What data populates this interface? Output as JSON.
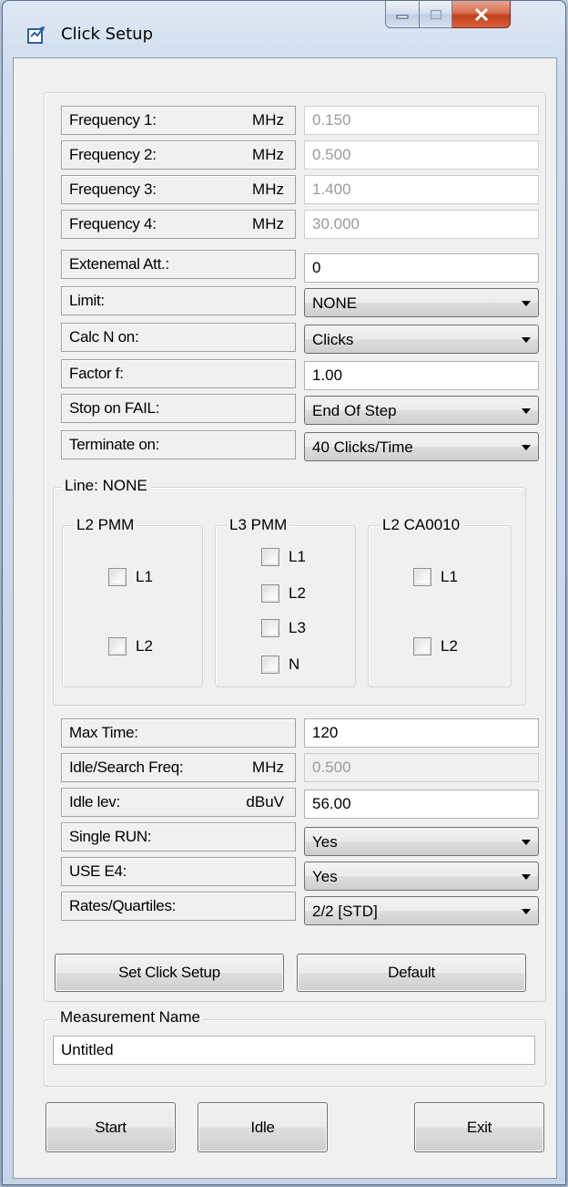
{
  "window": {
    "title": "Click Setup"
  },
  "params": [
    {
      "label": "Frequency 1:",
      "unit": "MHz",
      "value": "0.150"
    },
    {
      "label": "Frequency 2:",
      "unit": "MHz",
      "value": "0.500"
    },
    {
      "label": "Frequency 3:",
      "unit": "MHz",
      "value": "1.400"
    },
    {
      "label": "Frequency 4:",
      "unit": "MHz",
      "value": "30.000"
    },
    {
      "label": "Extenemal Att.:",
      "value": "0"
    },
    {
      "label": "Limit:",
      "value": "NONE"
    },
    {
      "label": "Calc N on:",
      "value": "Clicks"
    },
    {
      "label": "Factor f:",
      "value": "1.00"
    },
    {
      "label": "Stop on FAIL:",
      "value": "End Of Step"
    },
    {
      "label": "Terminate on:",
      "value": "40 Clicks/Time"
    }
  ],
  "line_group": {
    "title": "Line: NONE",
    "l2pmm": {
      "title": "L2 PMM",
      "items": [
        "L1",
        "L2"
      ]
    },
    "l3pmm": {
      "title": "L3 PMM",
      "items": [
        "L1",
        "L2",
        "L3",
        "N"
      ]
    },
    "l2ca": {
      "title": "L2 CA0010",
      "items": [
        "L1",
        "L2"
      ]
    }
  },
  "params2": [
    {
      "label": "Max Time:",
      "value": "120"
    },
    {
      "label": "Idle/Search Freq:",
      "unit": "MHz",
      "value": "0.500"
    },
    {
      "label": "Idle lev:",
      "unit": "dBuV",
      "value": "56.00"
    },
    {
      "label": "Single RUN:",
      "value": "Yes"
    },
    {
      "label": "USE E4:",
      "value": "Yes"
    },
    {
      "label": "Rates/Quartiles:",
      "value": "2/2 [STD]"
    }
  ],
  "buttons": {
    "set_click_setup": "Set Click Setup",
    "default": "Default",
    "start": "Start",
    "idle": "Idle",
    "exit": "Exit"
  },
  "measurement": {
    "title": "Measurement Name",
    "value": "Untitled"
  }
}
